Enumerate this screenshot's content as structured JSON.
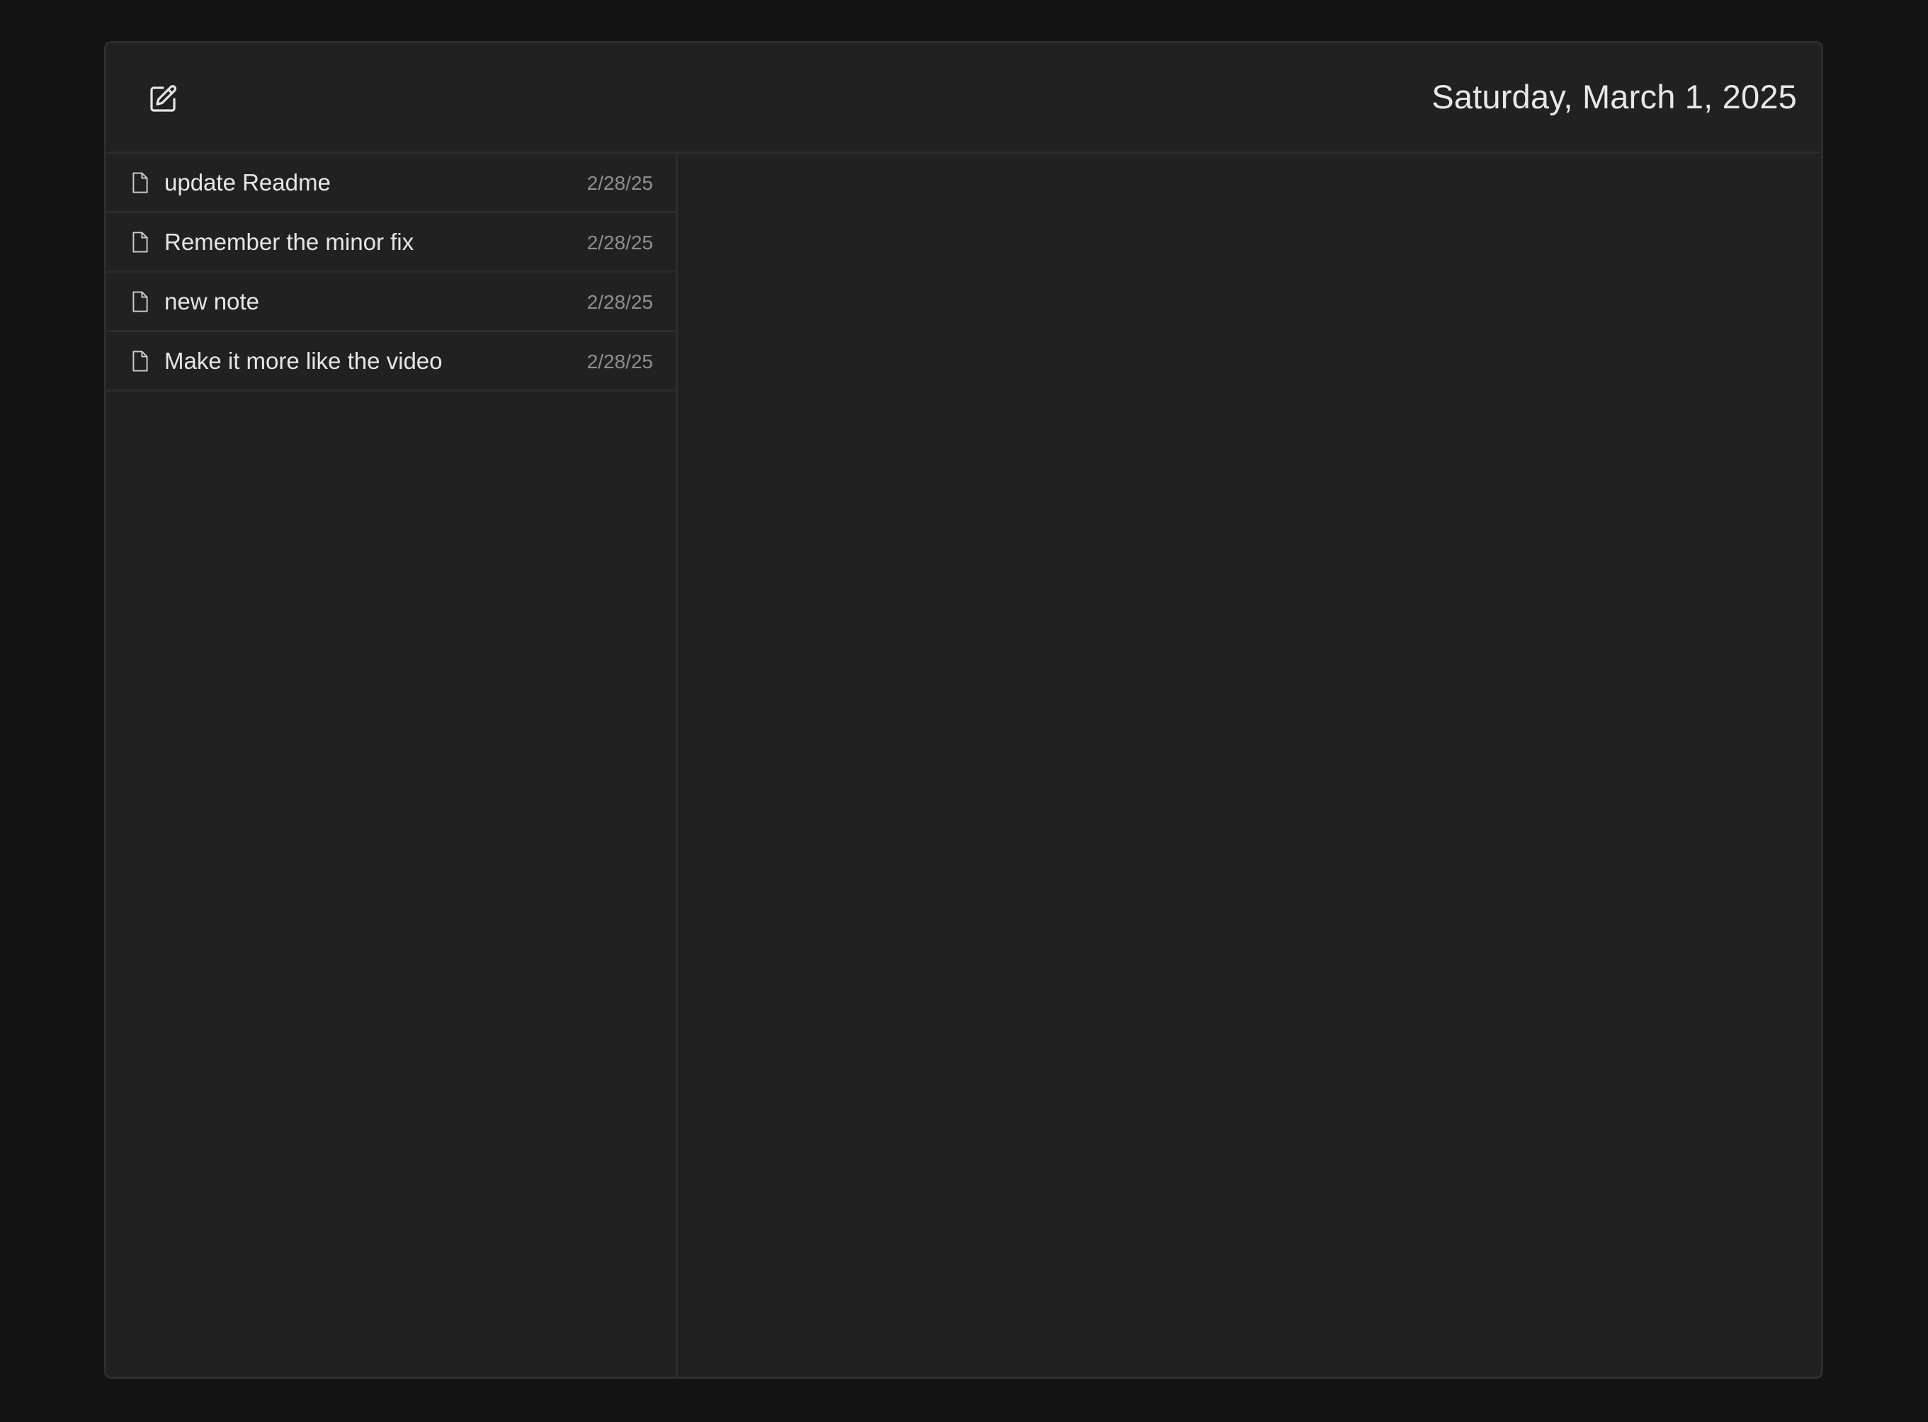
{
  "header": {
    "date": "Saturday, March 1, 2025",
    "compose_icon": "compose-icon"
  },
  "notes": [
    {
      "title": "update Readme",
      "date": "2/28/25",
      "icon": "document-icon"
    },
    {
      "title": "Remember the minor fix",
      "date": "2/28/25",
      "icon": "document-icon"
    },
    {
      "title": "new note",
      "date": "2/28/25",
      "icon": "document-icon"
    },
    {
      "title": "Make it more like the video",
      "date": "2/28/25",
      "icon": "document-icon"
    }
  ],
  "colors": {
    "page_background": "#141414",
    "window_background": "#212121",
    "divider": "#2c2c2c",
    "primary_text": "#e6e6e6",
    "secondary_text": "#8e8e93"
  }
}
